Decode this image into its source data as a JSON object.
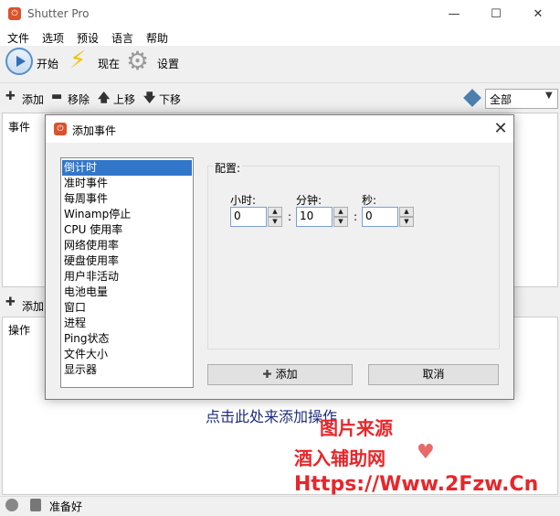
{
  "app": {
    "title": "Shutter Pro",
    "icon_glyph": "⏻"
  },
  "window_controls": {
    "minimize": "—",
    "maximize": "☐",
    "close": "✕"
  },
  "menu": [
    "文件",
    "选项",
    "预设",
    "语言",
    "帮助"
  ],
  "toolbar": {
    "start": "开始",
    "now": "现在",
    "settings": "设置"
  },
  "event_toolbar": {
    "add": "添加",
    "remove": "移除",
    "up": "上移",
    "down": "下移",
    "filter_value": "全部"
  },
  "events_panel": {
    "header": "事件"
  },
  "actions_toolbar": {
    "add": "添加"
  },
  "actions_panel": {
    "header": "操作",
    "hint": "点击此处来添加操作"
  },
  "status": {
    "text": "准备好"
  },
  "dialog": {
    "title": "添加事件",
    "close": "✕",
    "event_types": [
      "倒计时",
      "准时事件",
      "每周事件",
      "Winamp停止",
      "CPU 使用率",
      "网络使用率",
      "硬盘使用率",
      "用户非活动",
      "电池电量",
      "窗口",
      "进程",
      "Ping状态",
      "文件大小",
      "显示器"
    ],
    "selected_index": 0,
    "config": {
      "label": "配置:",
      "hours_label": "小时:",
      "hours_value": "0",
      "minutes_label": "分钟:",
      "minutes_value": "10",
      "seconds_label": "秒:",
      "seconds_value": "0",
      "separator": ":"
    },
    "add_button": "添加",
    "cancel_button": "取消"
  },
  "watermark": {
    "line1": "图片来源",
    "line2": "酒入辅助网",
    "line3": "Https://Www.2Fzw.Cn"
  }
}
